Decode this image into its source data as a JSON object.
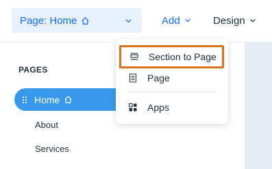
{
  "topbar": {
    "page_select_label": "Page: Home",
    "add_label": "Add",
    "design_label": "Design"
  },
  "pages_panel": {
    "title": "PAGES",
    "items": [
      {
        "label": "Home",
        "active": true
      },
      {
        "label": "About",
        "active": false
      },
      {
        "label": "Services",
        "active": false
      }
    ]
  },
  "add_menu": {
    "items": [
      {
        "label": "Section to Page",
        "icon": "section-icon",
        "highlighted": true
      },
      {
        "label": "Page",
        "icon": "page-icon",
        "highlighted": false
      },
      {
        "label": "Apps",
        "icon": "apps-icon",
        "highlighted": false
      }
    ]
  },
  "colors": {
    "accent": "#116dff",
    "active_item": "#3899ec",
    "select_bg": "#e7f0fd",
    "highlight_border": "#d9721f",
    "canvas": "#e5ecf6"
  }
}
